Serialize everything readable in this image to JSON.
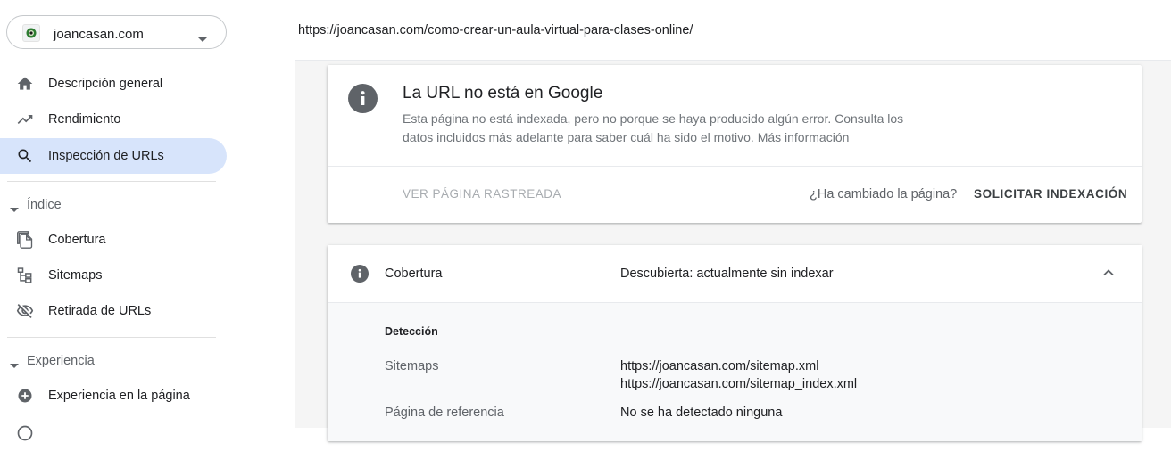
{
  "sidebar": {
    "property": {
      "name": "joancasan.com",
      "favicon": "site-favicon",
      "caret": "arrow-drop-down-icon"
    },
    "items": [
      {
        "label": "Descripción general",
        "icon": "home-icon"
      },
      {
        "label": "Rendimiento",
        "icon": "trending-up-icon"
      },
      {
        "label": "Inspección de URLs",
        "icon": "search-icon",
        "active": true
      }
    ],
    "sections": [
      {
        "label": "Índice",
        "items": [
          {
            "label": "Cobertura",
            "icon": "file-copy-icon"
          },
          {
            "label": "Sitemaps",
            "icon": "sitemap-icon"
          },
          {
            "label": "Retirada de URLs",
            "icon": "visibility-off-icon"
          }
        ]
      },
      {
        "label": "Experiencia",
        "items": [
          {
            "label": "Experiencia en la página",
            "icon": "add-circle-icon"
          }
        ]
      }
    ]
  },
  "header": {
    "inspected_url": "https://joancasan.com/como-crear-un-aula-virtual-para-clases-online/"
  },
  "status_card": {
    "icon": "info-icon",
    "title": "La URL no está en Google",
    "description": "Esta página no está indexada, pero no porque se haya producido algún error. Consulta los datos incluidos más adelante para saber cuál ha sido el motivo.",
    "more_info_link": "Más información",
    "view_crawled_label": "VER PÁGINA RASTREADA",
    "changed_question": "¿Ha cambiado la página?",
    "request_indexing_label": "SOLICITAR INDEXACIÓN"
  },
  "coverage": {
    "icon": "info-icon",
    "label": "Cobertura",
    "status": "Descubierta: actualmente sin indexar",
    "expand_icon": "chevron-up-icon",
    "detection": {
      "title": "Detección",
      "sitemaps_label": "Sitemaps",
      "sitemaps": [
        "https://joancasan.com/sitemap.xml",
        "https://joancasan.com/sitemap_index.xml"
      ],
      "referring_label": "Página de referencia",
      "referring_value": "No se ha detectado ninguna"
    }
  },
  "colors": {
    "active_nav_bg": "#d7e4fb",
    "icon_grey": "#5f6368",
    "content_bg": "#f5f5f5"
  }
}
